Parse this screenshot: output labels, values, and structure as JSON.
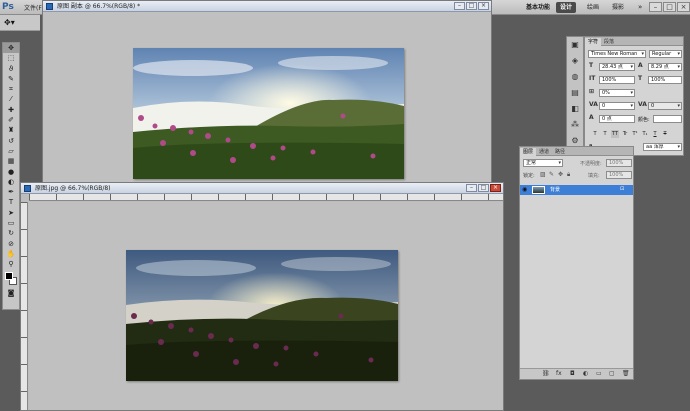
{
  "app": {
    "logo": "Ps",
    "menu_file": "文件(F)",
    "workspaces": [
      "基本功能",
      "设计",
      "绘画",
      "摄影",
      "»"
    ],
    "window_controls": [
      "–",
      "□",
      "×"
    ]
  },
  "doc1": {
    "title": "原图 副本 @ 66.7%(RGB/8) *"
  },
  "doc2": {
    "title": "原图.jpg @ 66.7%(RGB/8)"
  },
  "character_panel": {
    "tabs": [
      "字符",
      "段落"
    ],
    "font_family": "Times New Roman",
    "font_style": "Regular",
    "font_size": "28.43 点",
    "leading": "8.29 点",
    "vertical_scale": "100%",
    "horizontal_scale": "100%",
    "tracking_pct": "0%",
    "kerning": "0",
    "tracking": "0",
    "baseline_shift": "0 点",
    "color_label": "颜色:",
    "anti_alias": "浑厚",
    "style_buttons": [
      "T",
      "T",
      "TT",
      "Tr",
      "T¹",
      "T₁",
      "T",
      "T"
    ]
  },
  "layers_panel": {
    "tabs": [
      "图层",
      "通道",
      "路径"
    ],
    "blend_mode": "正常",
    "opacity_label": "不透明度:",
    "opacity": "100%",
    "lock_label": "锁定:",
    "fill_label": "填充:",
    "fill": "100%",
    "layers": [
      {
        "name": "背景",
        "visible": true,
        "locked": true,
        "selected": true
      }
    ],
    "footer_icons": [
      "link-icon",
      "fx-icon",
      "mask-icon",
      "adjustment-icon",
      "group-icon",
      "new-layer-icon",
      "trash-icon"
    ]
  },
  "toolbar": {
    "tools": [
      "move-tool",
      "marquee-tool",
      "lasso-tool",
      "quick-select-tool",
      "crop-tool",
      "eyedropper-tool",
      "healing-tool",
      "brush-tool",
      "clone-stamp-tool",
      "history-brush-tool",
      "eraser-tool",
      "gradient-tool",
      "blur-tool",
      "dodge-tool",
      "pen-tool",
      "type-tool",
      "path-select-tool",
      "shape-tool",
      "3d-rotate-tool",
      "3d-orbit-tool",
      "hand-tool",
      "zoom-tool"
    ],
    "foreground_color": "#000000",
    "background_color": "#ffffff"
  },
  "colors": {
    "selection": "#3d7fd6",
    "panel_bg": "#d4d4d4",
    "workspace_bg": "#5b5b5b",
    "canvas_bg": "#c0c0c0"
  }
}
